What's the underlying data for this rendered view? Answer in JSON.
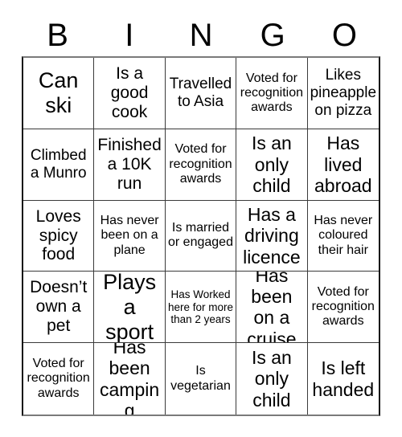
{
  "header": {
    "letters": [
      "B",
      "I",
      "N",
      "G",
      "O"
    ]
  },
  "grid": {
    "rows": 5,
    "columns": 5,
    "cells": [
      {
        "text": "Can ski",
        "size": "s-xxl"
      },
      {
        "text": "Is a good cook",
        "size": "s-lg"
      },
      {
        "text": "Travelled to Asia",
        "size": "s-md"
      },
      {
        "text": "Voted for recognition awards",
        "size": "s-sm"
      },
      {
        "text": "Likes pineapple on pizza",
        "size": "s-md"
      },
      {
        "text": "Climbed a Munro",
        "size": "s-md"
      },
      {
        "text": "Finished a 10K run",
        "size": "s-lg"
      },
      {
        "text": "Voted for recognition awards",
        "size": "s-sm"
      },
      {
        "text": "Is an only child",
        "size": "s-xl"
      },
      {
        "text": "Has lived abroad",
        "size": "s-xl"
      },
      {
        "text": "Loves spicy food",
        "size": "s-lg"
      },
      {
        "text": "Has never been on a plane",
        "size": "s-sm"
      },
      {
        "text": "Is married or engaged",
        "size": "s-sm"
      },
      {
        "text": "Has a driving licence",
        "size": "s-xl"
      },
      {
        "text": "Has never coloured their hair",
        "size": "s-sm"
      },
      {
        "text": "Doesn’t own a pet",
        "size": "s-lg"
      },
      {
        "text": "Plays a sport",
        "size": "s-xxl"
      },
      {
        "text": "Has Worked here for more than 2 years",
        "size": "s-xs"
      },
      {
        "text": "Has been on a cruise",
        "size": "s-xl"
      },
      {
        "text": "Voted for recognition awards",
        "size": "s-sm"
      },
      {
        "text": "Voted for recognition awards",
        "size": "s-sm"
      },
      {
        "text": "Has been camping",
        "size": "s-xl"
      },
      {
        "text": "Is vegetarian",
        "size": "s-sm"
      },
      {
        "text": "Is an only child",
        "size": "s-xl"
      },
      {
        "text": "Is left handed",
        "size": "s-xl"
      }
    ]
  },
  "colors": {
    "background": "#ffffff",
    "text": "#000000",
    "grid_line": "#3a3a3a",
    "grid_border": "#111111"
  }
}
